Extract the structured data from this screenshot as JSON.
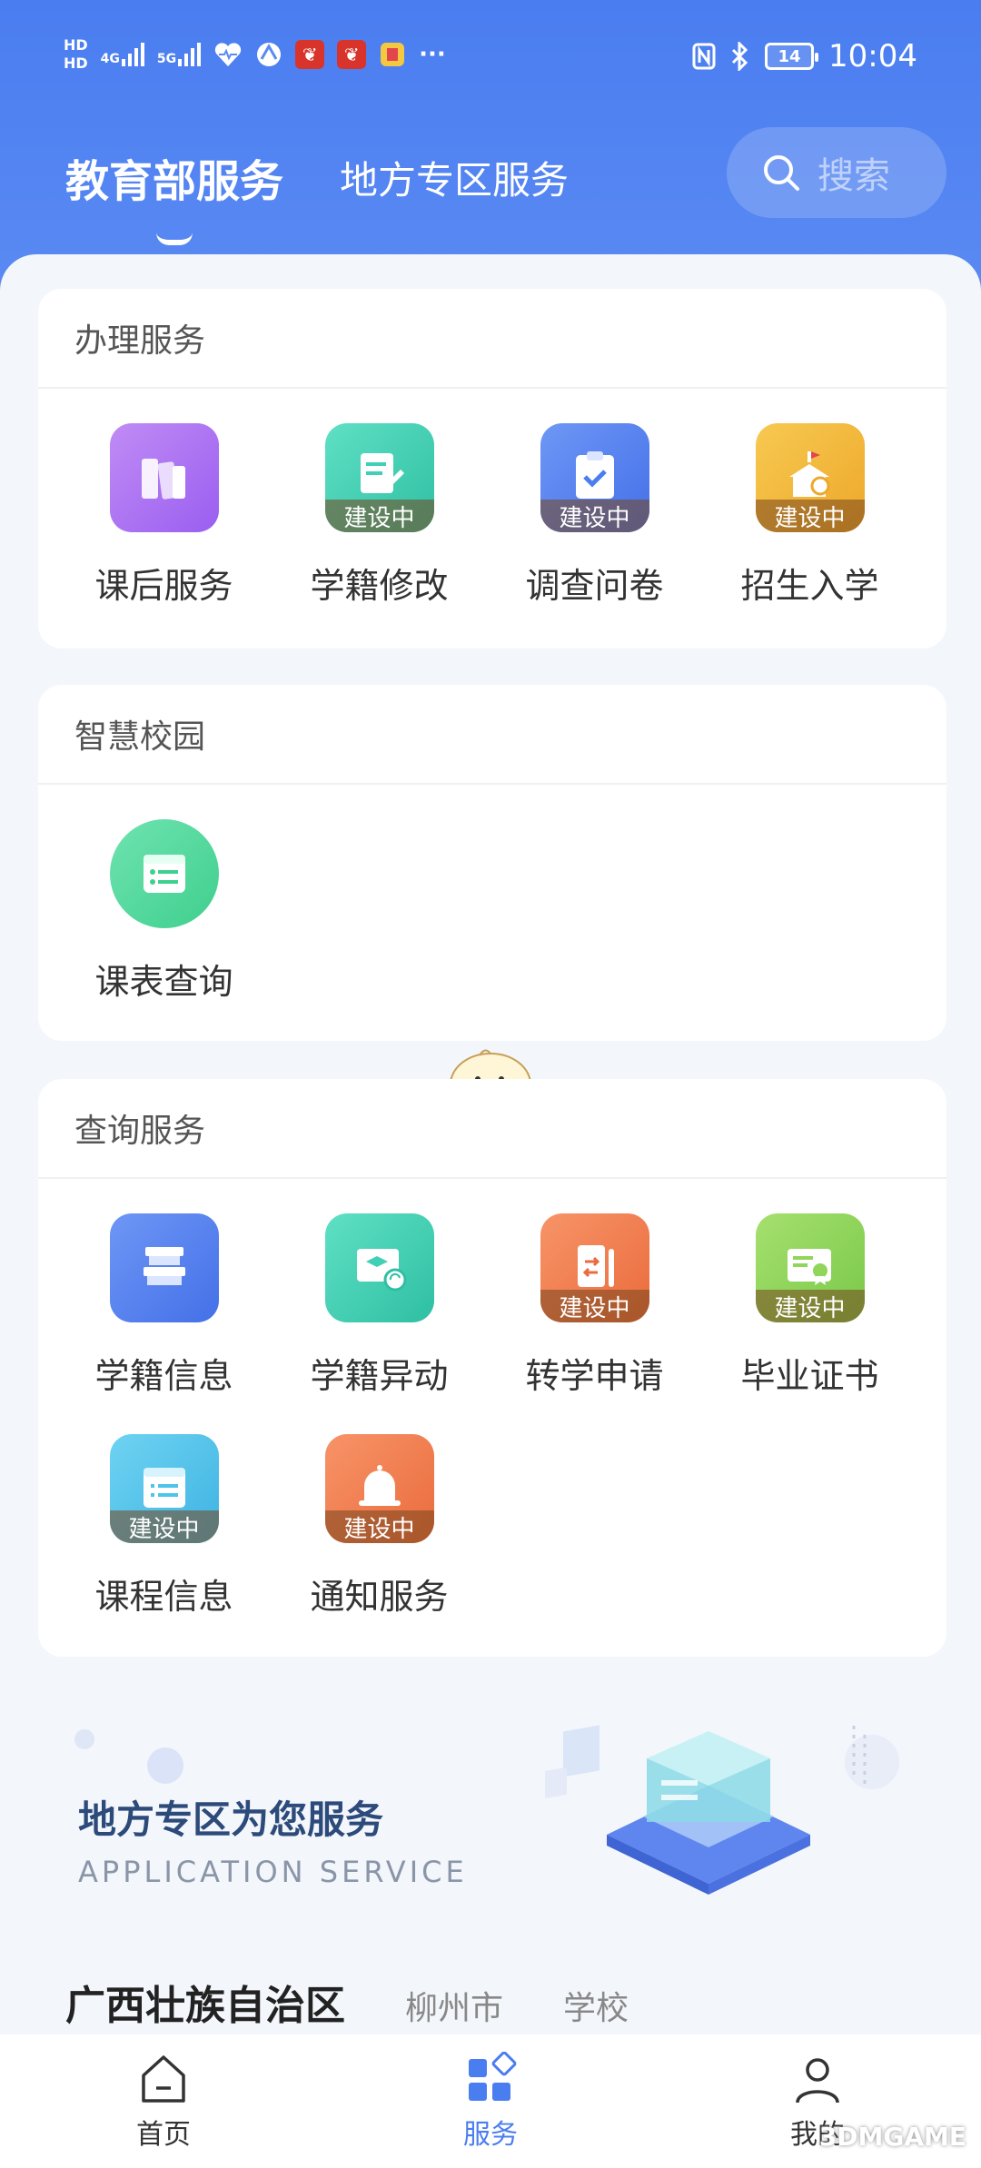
{
  "status_bar": {
    "hd1": "HD",
    "hd2": "HD",
    "net1": "4G",
    "net2": "5G",
    "dots": "···",
    "battery": "14",
    "time": "10:04"
  },
  "header": {
    "tabs": [
      {
        "label": "教育部服务",
        "active": true
      },
      {
        "label": "地方专区服务",
        "active": false
      }
    ],
    "search_label": "搜索"
  },
  "sections": [
    {
      "title": "办理服务",
      "items": [
        {
          "label": "课后服务",
          "icon": "books-icon",
          "wip": ""
        },
        {
          "label": "学籍修改",
          "icon": "edit-doc-icon",
          "wip": "建设中"
        },
        {
          "label": "调查问卷",
          "icon": "clipboard-check-icon",
          "wip": "建设中"
        },
        {
          "label": "招生入学",
          "icon": "school-icon",
          "wip": "建设中"
        }
      ]
    },
    {
      "title": "智慧校园",
      "items": [
        {
          "label": "课表查询",
          "icon": "timetable-icon",
          "wip": ""
        }
      ]
    },
    {
      "title": "查询服务",
      "items": [
        {
          "label": "学籍信息",
          "icon": "student-record-icon",
          "wip": ""
        },
        {
          "label": "学籍异动",
          "icon": "record-change-icon",
          "wip": ""
        },
        {
          "label": "转学申请",
          "icon": "transfer-icon",
          "wip": "建设中"
        },
        {
          "label": "毕业证书",
          "icon": "certificate-icon",
          "wip": "建设中"
        },
        {
          "label": "课程信息",
          "icon": "course-icon",
          "wip": "建设中"
        },
        {
          "label": "通知服务",
          "icon": "bell-icon",
          "wip": "建设中"
        }
      ]
    }
  ],
  "banner": {
    "title": "地方专区为您服务",
    "subtitle": "APPLICATION SERVICE"
  },
  "region_tabs": [
    {
      "label": "广西壮族自治区",
      "active": true
    },
    {
      "label": "柳州市",
      "active": false
    },
    {
      "label": "学校",
      "active": false
    }
  ],
  "bottom_nav": [
    {
      "label": "首页",
      "icon": "home-icon",
      "active": false
    },
    {
      "label": "服务",
      "icon": "services-icon",
      "active": true
    },
    {
      "label": "我的",
      "icon": "user-icon",
      "active": false
    }
  ],
  "watermark": "3DMGAME",
  "colors": {
    "primary": "#4a7df0",
    "purple": "#a96cf2",
    "teal": "#3fd0b5",
    "blue": "#5b82f0",
    "yellow": "#f3b93d",
    "green": "#4fd69c",
    "orange": "#f07a4e",
    "lime": "#8fd65a",
    "sky": "#4ec4ea"
  }
}
